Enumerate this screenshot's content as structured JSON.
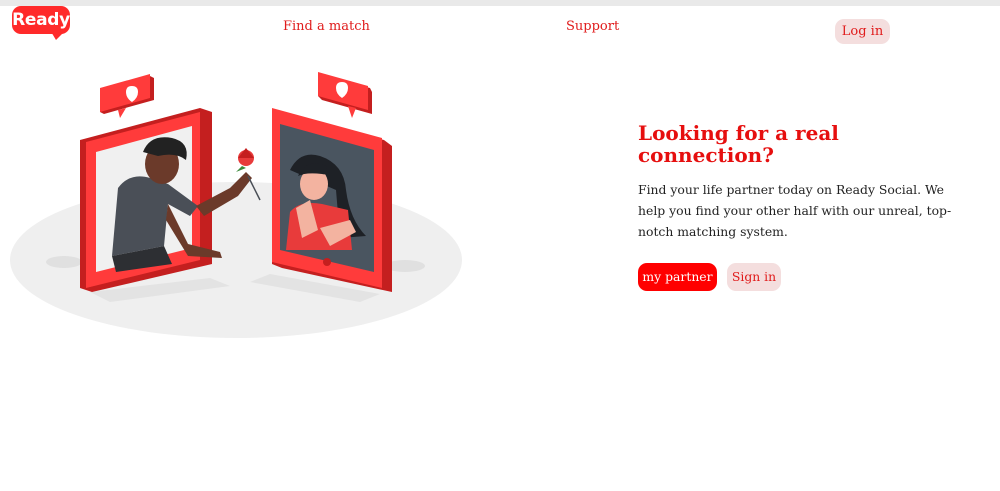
{
  "brand": {
    "logo_text": "Ready",
    "color": "#ff2a2a"
  },
  "nav": {
    "find_match": "Find a match",
    "support": "Support",
    "login": "Log in"
  },
  "hero": {
    "title": "Looking for a real connection?",
    "description": "Find your life partner today on Ready Social. We help you find your other half with our unreal, top-notch matching system.",
    "primary_button": "my partner",
    "secondary_button": "Sign in"
  },
  "illustration": {
    "subject": "couple-on-phones-illustration",
    "icons": [
      "heart-icon",
      "heart-icon",
      "rose-icon"
    ]
  },
  "colors": {
    "accent": "#ff0000",
    "link": "#e01b1b",
    "button_soft": "#f4dede"
  }
}
